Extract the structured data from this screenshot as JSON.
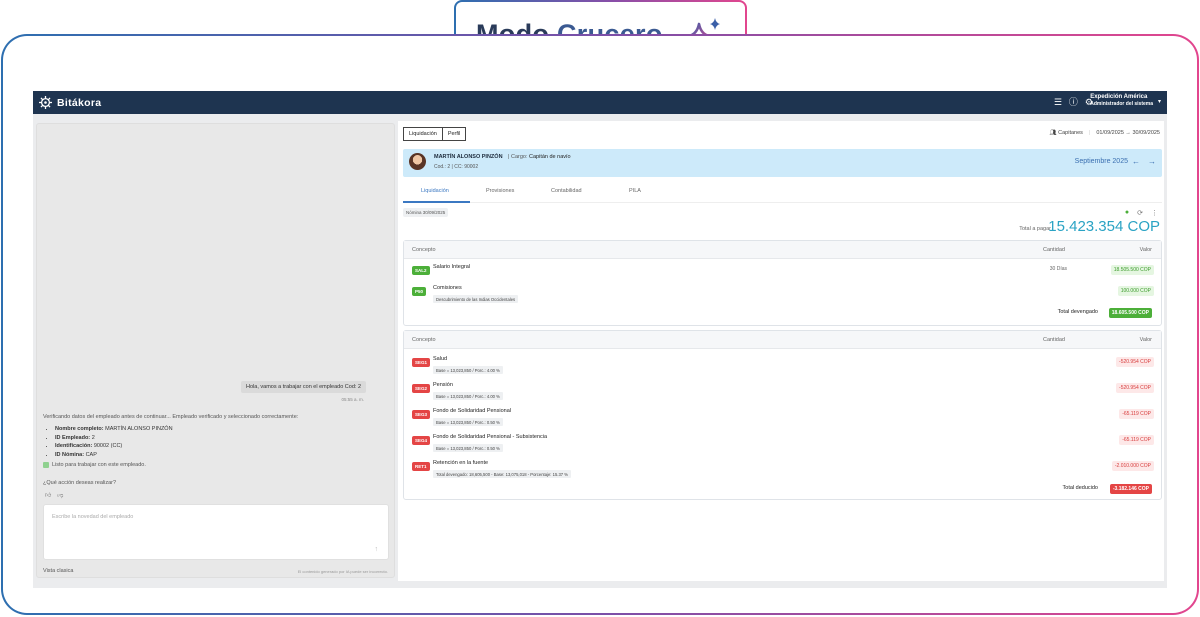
{
  "banner": {
    "title_a": "Modo",
    "title_b": "Crucero"
  },
  "app": {
    "brand": "Bitákora",
    "user": {
      "name": "Expedición América",
      "role": "Administrador del sistema"
    }
  },
  "chat": {
    "user_message": "Hola, vamos a trabajar con el empleado Cod: 2",
    "user_message_time": "05:55 a. m.",
    "bot_intro": "Verificando datos del empleado antes de continuar... Empleado verificado y seleccionado correctamente:",
    "bot_details": [
      {
        "label": "Nombre completo:",
        "value": "MARTÍN ALONSO PINZÓN"
      },
      {
        "label": "ID Empleado:",
        "value": "2"
      },
      {
        "label": "Identificación:",
        "value": "90002 (CC)"
      },
      {
        "label": "ID Nómina:",
        "value": "CAP"
      }
    ],
    "ready_text": "Listo para trabajar con este empleado.",
    "question": "¿Qué acción deseas realizar?",
    "input_placeholder": "Escribe la novedad del empleado",
    "classic_view": "Vista clasica",
    "disclaimer": "El contenido generado por IA puede ser incorrecto."
  },
  "panel": {
    "top_tabs": [
      "Liquidación",
      "Perfil"
    ],
    "group": "Capitanes",
    "range_start": "01/09/2025",
    "range_end": "30/09/2025",
    "employee": {
      "name": "MARTÍN ALONSO PINZÓN",
      "cargo_label": "Cargo:",
      "cargo": "Capitán de navío",
      "cod": "Cod.: 2",
      "cc": "CC: 90002",
      "period": "Septiembre 2025"
    },
    "subtabs": [
      "Liquidación",
      "Provisiones",
      "Contabilidad",
      "PILA"
    ],
    "nomina_chip": "Nómina 30/09/2025",
    "total_label": "Total a pagar",
    "total_value": "15.423.354 COP",
    "headers": {
      "concepto": "Concepto",
      "cantidad": "Cantidad",
      "valor": "Valor"
    },
    "devengos": [
      {
        "code": "SAL2",
        "name": "Salario Integral",
        "desc": "",
        "qty": "30 Días",
        "value": "18.505.500 COP"
      },
      {
        "code": "P50",
        "name": "Comisiones",
        "desc": "Descubrimiento de las Indias Occidentales",
        "qty": "",
        "value": "100.000 COP"
      }
    ],
    "total_devengado_label": "Total devengado",
    "total_devengado": "18.605.500 COP",
    "deducciones": [
      {
        "code": "SEG1",
        "name": "Salud",
        "desc": "Base = 13,023,850 / Porc.: 4.00 %",
        "value": "-520.954 COP"
      },
      {
        "code": "SEG2",
        "name": "Pensión",
        "desc": "Base = 13,023,850 / Porc.: 4.00 %",
        "value": "-520.954 COP"
      },
      {
        "code": "SEG3",
        "name": "Fondo de Solidaridad Pensional",
        "desc": "Base = 13,023,850 / Porc.: 0.50 %",
        "value": "-65.119 COP"
      },
      {
        "code": "SEG4",
        "name": "Fondo de Solidaridad Pensional - Subsistencia",
        "desc": "Base = 13,023,850 / Porc.: 0.50 %",
        "value": "-65.119 COP"
      },
      {
        "code": "RET1",
        "name": "Retención en la fuente",
        "desc": "Total devengado: 18,605,500 - Base: 13,075,018 - Porcentaje: 15.37 %",
        "value": "-2.010.000 COP"
      }
    ],
    "total_deducido_label": "Total deducido",
    "total_deducido": "-3.182.146 COP"
  }
}
